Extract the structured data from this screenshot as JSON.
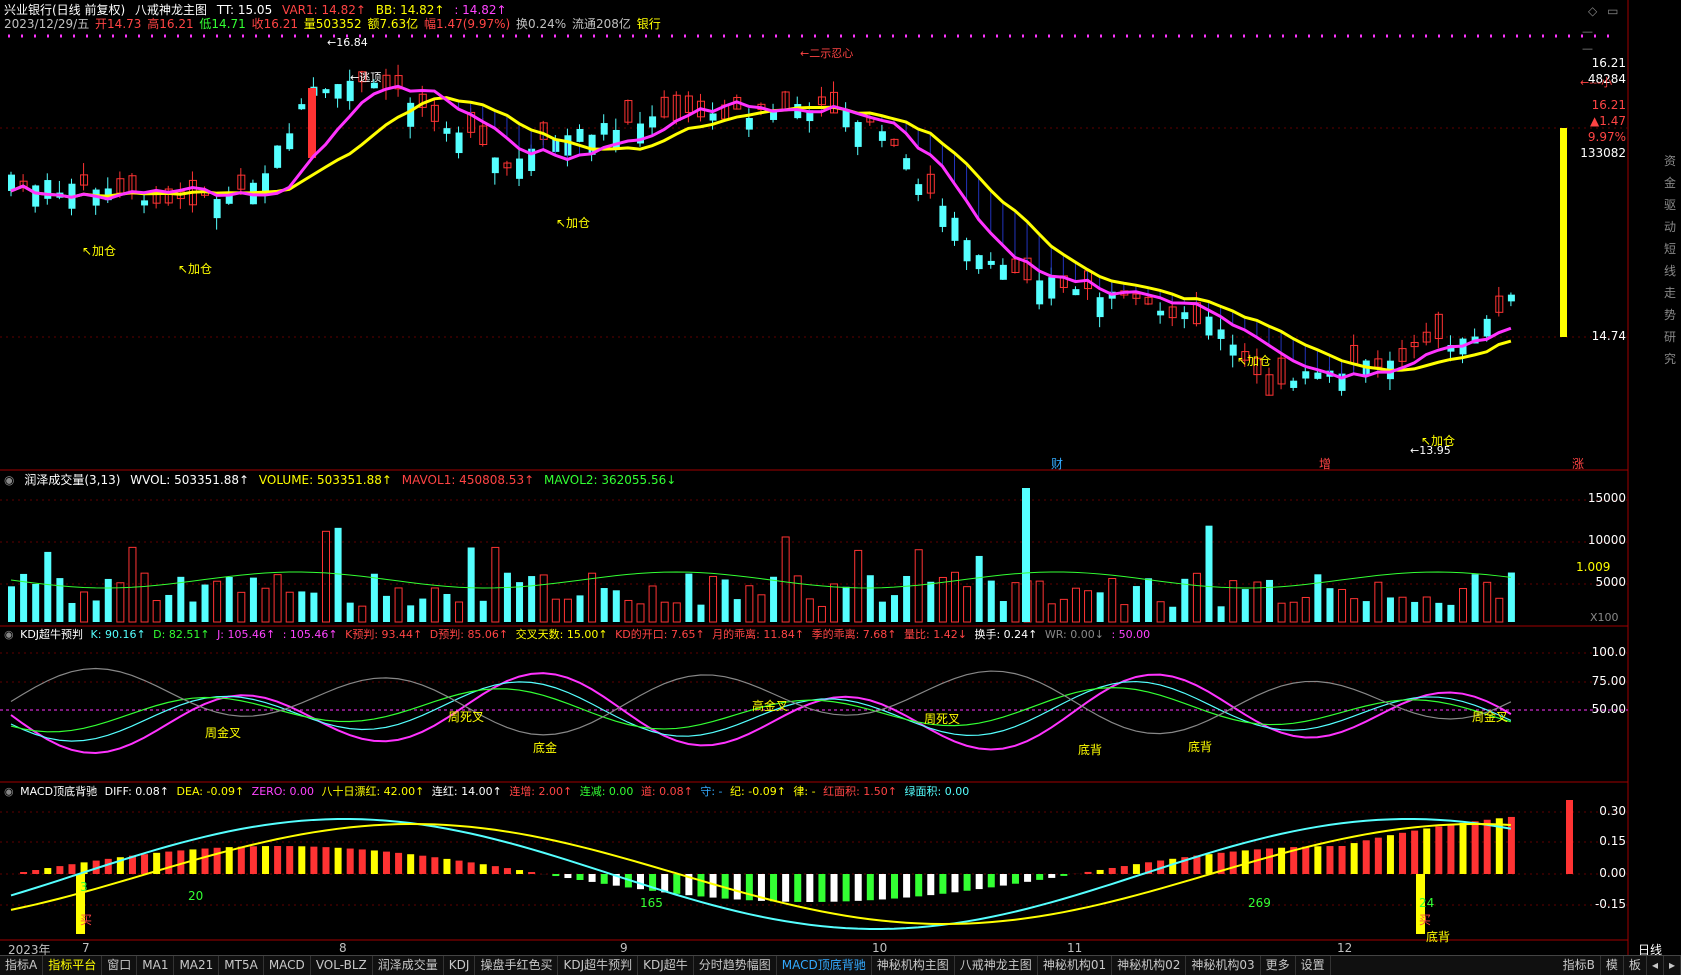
{
  "header": {
    "stock": "兴业银行(日线 前复权)",
    "indicator": "八戒神龙主图",
    "tt": "TT: 15.05",
    "var1": "VAR1: 14.82↑",
    "bb": "BB: 14.82↑",
    "extra": ": 14.82↑",
    "date": "2023/12/29/五",
    "open": "开14.73",
    "high": "高16.21",
    "low": "低14.71",
    "close": "收16.21",
    "vol": "量503352",
    "amount": "额7.63亿",
    "change": "幅1.47(9.97%)",
    "turnover": "换0.24%",
    "float": "流通208亿",
    "sector": "银行"
  },
  "right_panel": {
    "price1": "16.21",
    "vol": "48284",
    "price2": "16.21",
    "up": "▲1.47",
    "pct": "9.97%",
    "total": "133082",
    "level": "14.74",
    "side_text": "资金驱动短线走势研究",
    "arrow_label": "←---小"
  },
  "main_annotations": {
    "high_label": "←16.84",
    "low_label": "←13.95",
    "fen_label": "←二示忍心",
    "jiacang": "↖加仓",
    "top_label": "←逃顶",
    "markers": [
      "财",
      "增",
      "涨"
    ]
  },
  "vol_panel": {
    "title": "润泽成交量(3,13)",
    "wvol": "WVOL: 503351.88↑",
    "volume": "VOLUME: 503351.88↑",
    "mavol1": "MAVOL1: 450808.53↑",
    "mavol2": "MAVOL2: 362055.56↓",
    "ticks": [
      "15000",
      "10000",
      "5000"
    ],
    "unit": "X100",
    "ratio": "1.009"
  },
  "kdj_panel": {
    "title": "KDJ超牛预判",
    "k": "K: 90.16↑",
    "d": "D: 82.51↑",
    "j": "J: 105.46↑",
    "j2": ": 105.46↑",
    "kp": "K预判: 93.44↑",
    "dp": "D预判: 85.06↑",
    "cross": "交叉天数: 15.00↑",
    "kdopen": "KD的开口: 7.65↑",
    "mhigh": "月的乖离: 11.84↑",
    "qhigh": "季的乖离: 7.68↑",
    "ratio": "量比: 1.42↓",
    "hs": "换手: 0.24↑",
    "wr": "WR: 0.00↓",
    "fifty": ": 50.00",
    "ticks": [
      "100.0",
      "75.00",
      "50.00"
    ],
    "labels": [
      "周金叉",
      "周死叉",
      "底金",
      "高金叉",
      "周死叉",
      "底背",
      "底背",
      "周金叉"
    ]
  },
  "macd_panel": {
    "title": "MACD顶底背驰",
    "diff": "DIFF: 0.08↑",
    "dea": "DEA: -0.09↑",
    "zero": "ZERO: 0.00",
    "d80": "八十日漂红: 42.00↑",
    "lh": "连红: 14.00↑",
    "lz": "连增: 2.00↑",
    "lj": "连减: 0.00",
    "dao": "道: 0.08↑",
    "shou": "守: -",
    "ji": "纪: -0.09↑",
    "lv": "律: -",
    "hm": "红面积: 1.50↑",
    "lm": "绿面积: 0.00",
    "ticks": [
      "0.30",
      "0.15",
      "0.00",
      "-0.15"
    ],
    "counts": [
      "3",
      "20",
      "165",
      "269",
      "24"
    ],
    "labels": [
      "买",
      "买",
      "底背"
    ]
  },
  "x_axis": {
    "year": "2023年",
    "months": [
      "7",
      "8",
      "9",
      "10",
      "11",
      "12"
    ],
    "period": "日线"
  },
  "tabs": [
    "指标A",
    "指标平台",
    "窗口",
    "MA1",
    "MA21",
    "MT5A",
    "MACD",
    "VOL-BLZ",
    "润泽成交量",
    "KDJ",
    "操盘手红色买",
    "KDJ超牛预判",
    "KDJ超牛",
    "分时趋势幅图",
    "MACD顶底背驰",
    "神秘机构主图",
    "八戒神龙主图",
    "神秘机构01",
    "神秘机构02",
    "神秘机构03",
    "更多",
    "设置"
  ],
  "tabs_right": [
    "指标B",
    "模",
    "板"
  ],
  "colors": {
    "red": "#ff3333",
    "cyan": "#55ffff",
    "yellow": "#ffff00",
    "magenta": "#ff33ff",
    "green": "#33ff33",
    "white": "#ffffff",
    "grid": "#a00000"
  }
}
